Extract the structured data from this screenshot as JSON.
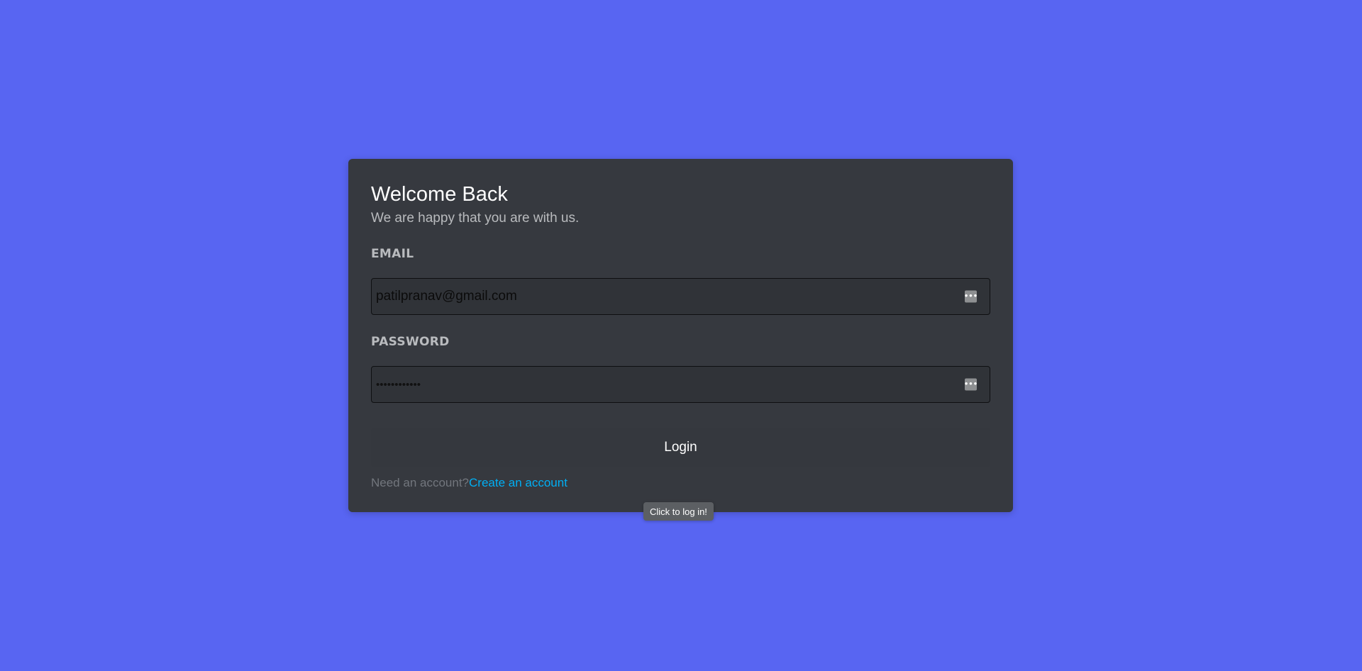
{
  "colors": {
    "background": "#5865f2",
    "card": "#36393f",
    "link": "#00aff4"
  },
  "header": {
    "title": "Welcome Back",
    "subtitle": "We are happy that you are with us."
  },
  "form": {
    "email": {
      "label": "EMAIL",
      "value": "patilpranav@gmail.com",
      "icon": "autofill-key-icon"
    },
    "password": {
      "label": "PASSWORD",
      "masked_value": "••••••••••••",
      "icon": "autofill-key-icon"
    },
    "submit_label": "Login"
  },
  "register": {
    "prompt": "Need an account?",
    "link_label": "Create an account"
  },
  "tooltip": {
    "text": "Click to log in!"
  }
}
